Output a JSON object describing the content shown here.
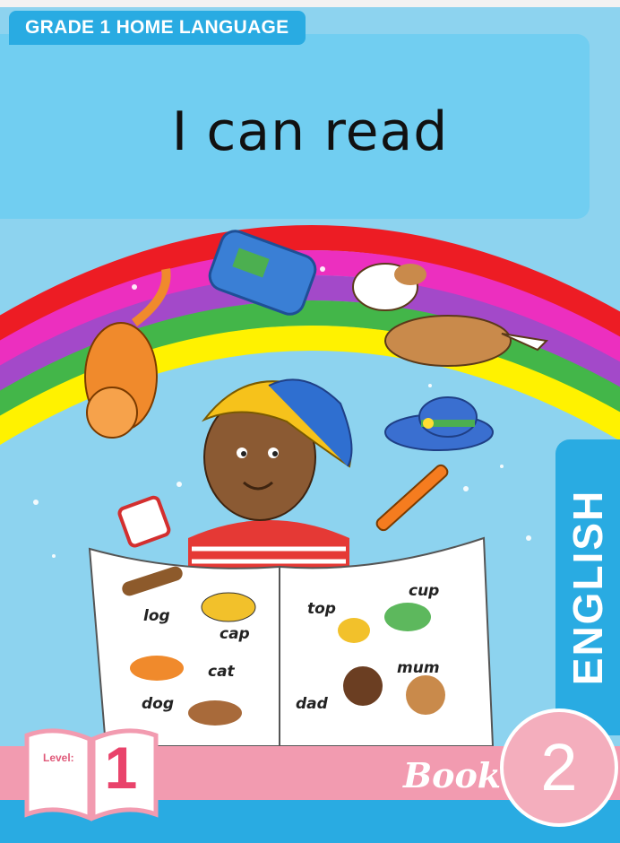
{
  "header": {
    "grade_label": "GRADE 1 HOME LANGUAGE",
    "title": "I can read"
  },
  "side_tab": {
    "label": "ENGLISH"
  },
  "footer": {
    "level_label": "Level:",
    "level_number": "1",
    "book_label": "Book",
    "book_number": "2"
  },
  "book_page": {
    "words": [
      "log",
      "cap",
      "cat",
      "dog",
      "top",
      "cup",
      "mum",
      "dad"
    ]
  },
  "colors": {
    "brand_blue": "#29abe2",
    "title_panel": "#71cef1",
    "pink_band": "#f29bb0",
    "level_pink": "#e9436b"
  }
}
